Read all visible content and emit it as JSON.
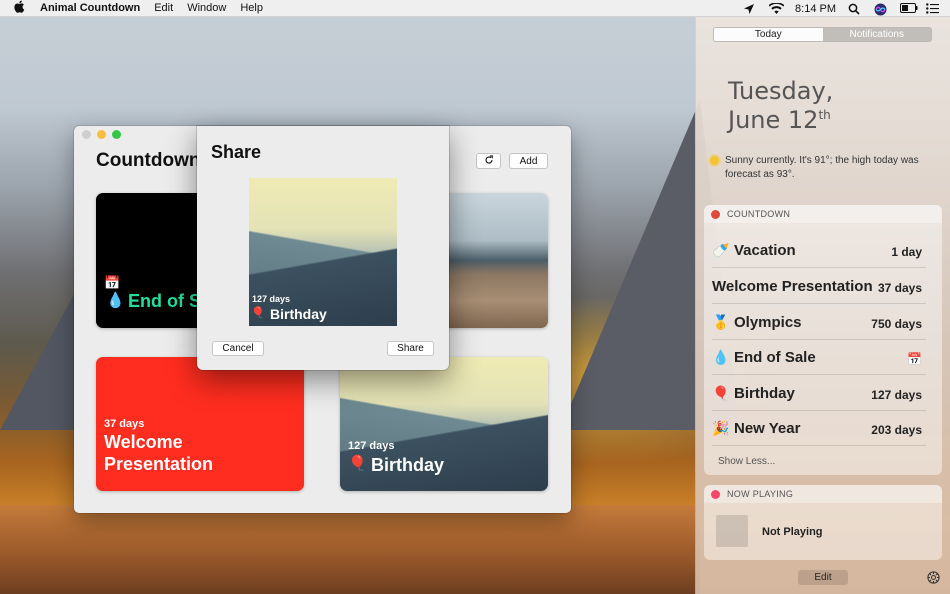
{
  "menubar": {
    "app_name": "Animal Countdown",
    "menus": [
      "Edit",
      "Window",
      "Help"
    ],
    "time": "8:14 PM"
  },
  "window": {
    "title": "Countdown",
    "add_label": "Add",
    "cards": [
      {
        "days": "",
        "name": "End of S",
        "emoji": "💧",
        "sub_emoji": "📅"
      },
      {
        "days": "",
        "name": ""
      },
      {
        "days": "37 days",
        "name": "Welcome Presentation"
      },
      {
        "days": "127 days",
        "name": "Birthday",
        "emoji": "🎈"
      }
    ]
  },
  "share_sheet": {
    "title": "Share",
    "preview_days": "127 days",
    "preview_name": "Birthday",
    "preview_emoji": "🎈",
    "cancel_label": "Cancel",
    "share_label": "Share"
  },
  "notification_center": {
    "tabs": [
      "Today",
      "Notifications"
    ],
    "selected_tab": "Today",
    "date_line1": "Tuesday,",
    "date_line2": "June 12",
    "date_suffix": "th",
    "weather": "Sunny currently. It's 91°; the high today was forecast as 93°.",
    "countdown_widget": {
      "header": "COUNTDOWN",
      "items": [
        {
          "emoji": "🍼",
          "name": "Vacation",
          "value": "1 day"
        },
        {
          "emoji": "",
          "name": "Welcome Presentation",
          "value": "37 days"
        },
        {
          "emoji": "🥇",
          "name": "Olympics",
          "value": "750 days"
        },
        {
          "emoji": "💧",
          "name": "End of Sale",
          "value": "📅"
        },
        {
          "emoji": "🎈",
          "name": "Birthday",
          "value": "127 days"
        },
        {
          "emoji": "🎉",
          "name": "New Year",
          "value": "203 days"
        }
      ],
      "show_less": "Show Less..."
    },
    "now_playing_widget": {
      "header": "NOW PLAYING",
      "status": "Not Playing"
    },
    "edit_label": "Edit"
  },
  "colors": {
    "card_red": "#ff2d1f",
    "card_green_text": "#1fe0a0",
    "traffic_close": "#fc605c",
    "traffic_min": "#fdbc40",
    "traffic_max": "#34c84a"
  }
}
